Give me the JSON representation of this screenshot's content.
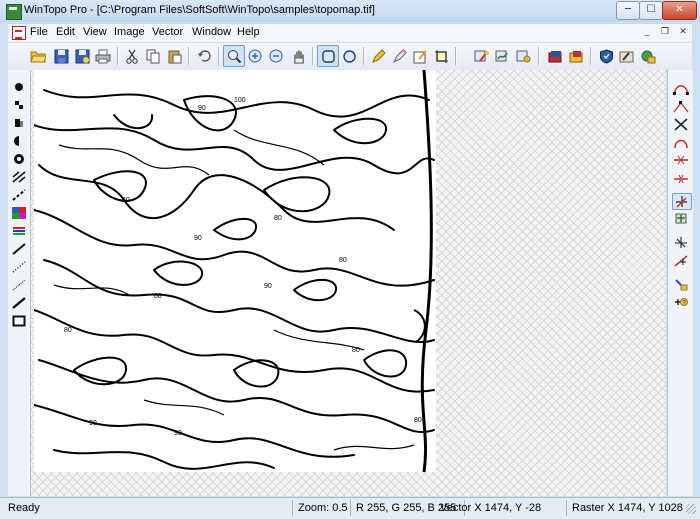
{
  "window": {
    "title": "WinTopo Pro - [C:\\Program Files\\SoftSoft\\WinTopo\\samples\\topomap.tif]"
  },
  "menu": [
    "File",
    "Edit",
    "View",
    "Image",
    "Vector",
    "Window",
    "Help"
  ],
  "mdi_controls": {
    "minimize": "_",
    "restore": "❐",
    "close": "✕"
  },
  "window_controls": {
    "minimize": "─",
    "maximize": "☐",
    "close": "✕"
  },
  "map_labels": [
    "90",
    "100",
    "80",
    "80",
    "80",
    "90",
    "80",
    "80",
    "90",
    "90",
    "80",
    "90",
    "80"
  ],
  "status": {
    "ready": "Ready",
    "zoom": "Zoom: 0.5",
    "rgb": "R 255, G 255, B 255",
    "vector": "Vector  X 1474, Y -28",
    "raster": "Raster  X 1474, Y 1028"
  },
  "colors": {
    "title_bg": "#c9dcf2",
    "close_button": "#c8452c",
    "canvas_hatch": "#d6d6d6",
    "map_ink": "#000000"
  },
  "toolbar_icons": [
    "open-folder-icon",
    "save-icon",
    "save-as-icon",
    "print-icon",
    "cut-icon",
    "copy-icon",
    "paste-icon",
    "undo-icon",
    "zoom-window-icon",
    "zoom-in-icon",
    "zoom-out-icon",
    "pan-hand-icon",
    "select-rect-icon",
    "select-circle-icon",
    "pencil-icon",
    "erase-icon",
    "edit-icon",
    "crop-icon",
    "auto-trace-icon",
    "smooth-icon",
    "filter-icon",
    "layer-red-icon",
    "layer-yellow-icon",
    "shield-icon",
    "run-icon",
    "export-icon"
  ],
  "left_tools": [
    "point-icon",
    "brush-small-icon",
    "brush-large-icon",
    "fill-half-icon",
    "fill-circle-icon",
    "line-hatch-icon",
    "dashed-line-icon",
    "color-palette-icon",
    "color-lines-icon",
    "pencil-draw-icon",
    "dots-line-icon",
    "dotted-line-icon",
    "straight-line-icon",
    "rectangle-icon"
  ],
  "right_tools": [
    "node-edit-icon",
    "node-move-icon",
    "cross-icon",
    "arc-icon",
    "join-icon",
    "split-icon",
    "pick-point-icon",
    "add-vertex-icon",
    "snap-icon",
    "measure-icon",
    "hand-pick-icon",
    "info-icon"
  ]
}
